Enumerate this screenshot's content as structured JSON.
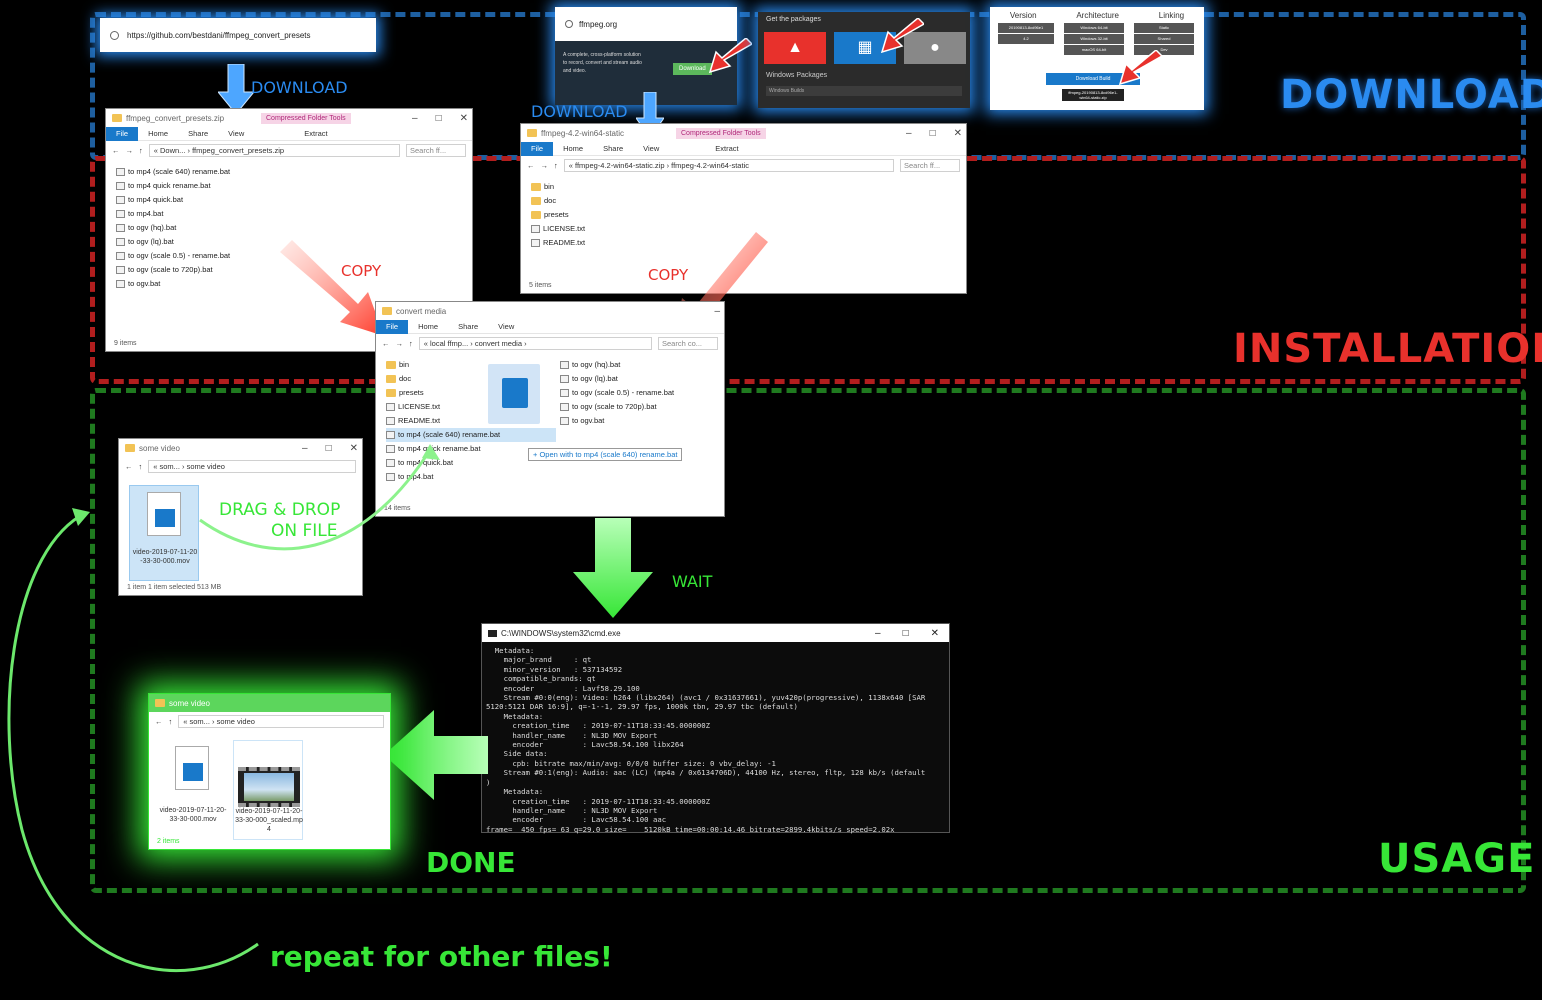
{
  "sections": {
    "download": "DOWNLOAD",
    "installation": "INSTALLATION",
    "usage": "USAGE"
  },
  "colors": {
    "blue": "#2a8bf0",
    "red": "#e8312c",
    "green": "#37e637"
  },
  "steps": {
    "download_left": "DOWNLOAD",
    "download_mid": "DOWNLOAD",
    "copy_left": "COPY",
    "copy_right": "COPY",
    "drag_drop_1": "DRAG & DROP",
    "drag_drop_2": "ON FILE",
    "wait": "WAIT",
    "done": "DONE",
    "repeat": "repeat for other files!"
  },
  "github": {
    "url": "https://github.com/bestdani/ffmpeg_convert_presets"
  },
  "ffmpeg_site": {
    "url": "ffmpeg.org",
    "blurb": "A complete, cross-platform solution to record, convert and stream audio and video.",
    "download_btn": "Download",
    "packages_title": "Get the packages",
    "windows_packages": "Windows Packages",
    "windows_builds": "Windows Builds"
  },
  "zeranoe": {
    "headers": [
      "Version",
      "Architecture",
      "Linking"
    ],
    "version": [
      "20190813-8cd96e1",
      "4.2"
    ],
    "arch": [
      "Windows 64-bit",
      "Windows 32-bit",
      "macOS 64-bit"
    ],
    "linking": [
      "Static",
      "Shared",
      "Dev"
    ],
    "download_build": "Download Build",
    "file": "ffmpeg-20190813-8cd96e1-win64-static.zip"
  },
  "win_presets": {
    "title": "ffmpeg_convert_presets.zip",
    "compressed": "Compressed Folder Tools",
    "tabs": [
      "File",
      "Home",
      "Share",
      "View"
    ],
    "extract": "Extract",
    "path": "«  Down...  ›  ffmpeg_convert_presets.zip",
    "search": "Search ff...",
    "files": [
      "to mp4 (scale 640) rename.bat",
      "to mp4 quick rename.bat",
      "to mp4 quick.bat",
      "to mp4.bat",
      "to ogv (hq).bat",
      "to ogv (lq).bat",
      "to ogv (scale 0.5) - rename.bat",
      "to ogv (scale to 720p).bat",
      "to ogv.bat"
    ],
    "status": "9 items"
  },
  "win_ffmpeg": {
    "title": "ffmpeg-4.2-win64-static",
    "compressed": "Compressed Folder Tools",
    "tabs": [
      "File",
      "Home",
      "Share",
      "View"
    ],
    "extract": "Extract",
    "path": "«  ffmpeg-4.2-win64-static.zip  ›  ffmpeg-4.2-win64-static",
    "search": "Search ff...",
    "folders": [
      "bin",
      "doc",
      "presets"
    ],
    "files": [
      "LICENSE.txt",
      "README.txt"
    ],
    "status": "5 items"
  },
  "win_convert": {
    "title": "convert media",
    "tabs": [
      "File",
      "Home",
      "Share",
      "View"
    ],
    "path": "«  local ffmp...  ›  convert media  ›",
    "search": "Search co...",
    "folders": [
      "bin",
      "doc",
      "presets"
    ],
    "files_left": [
      "LICENSE.txt",
      "README.txt",
      "to mp4 (scale 640) rename.bat",
      "to mp4 quick rename.bat",
      "to mp4 quick.bat",
      "to mp4.bat"
    ],
    "files_right": [
      "to ogv (hq).bat",
      "to ogv (lq).bat",
      "to ogv (scale 0.5) - rename.bat",
      "to ogv (scale to 720p).bat",
      "to ogv.bat"
    ],
    "tooltip": "+ Open with to mp4 (scale 640) rename.bat",
    "status": "14 items"
  },
  "win_video": {
    "title": "some video",
    "path": "«  som...  ›  some video",
    "file": "video-2019-07-11-20-33-30-000.mov",
    "status": "1 item     1 item selected  513 MB"
  },
  "win_done": {
    "title": "some video",
    "path": "«  som...  ›  some video",
    "file1": "video-2019-07-11-20-33-30-000.mov",
    "file2": "video-2019-07-11-20-33-30-000_scaled.mp4",
    "status": "2 items"
  },
  "cmd": {
    "title": "C:\\WINDOWS\\system32\\cmd.exe",
    "lines": "  Metadata:\n    major_brand     : qt\n    minor_version   : 537134592\n    compatible_brands: qt\n    encoder         : Lavf58.29.100\n    Stream #0:0(eng): Video: h264 (libx264) (avc1 / 0x31637661), yuv420p(progressive), 1138x640 [SAR\n5120:5121 DAR 16:9], q=-1--1, 29.97 fps, 1000k tbn, 29.97 tbc (default)\n    Metadata:\n      creation_time   : 2019-07-11T18:33:45.000000Z\n      handler_name    : NL3D MOV Export\n      encoder         : Lavc58.54.100 libx264\n    Side data:\n      cpb: bitrate max/min/avg: 0/0/0 buffer size: 0 vbv_delay: -1\n    Stream #0:1(eng): Audio: aac (LC) (mp4a / 0x6134706D), 44100 Hz, stereo, fltp, 128 kb/s (default\n)\n    Metadata:\n      creation_time   : 2019-07-11T18:33:45.000000Z\n      handler_name    : NL3D MOV Export\n      encoder         : Lavc58.54.100 aac\nframe=  450 fps= 63 q=29.0 size=    5120kB time=00:00:14.46 bitrate=2899.4kbits/s speed=2.02x"
  }
}
